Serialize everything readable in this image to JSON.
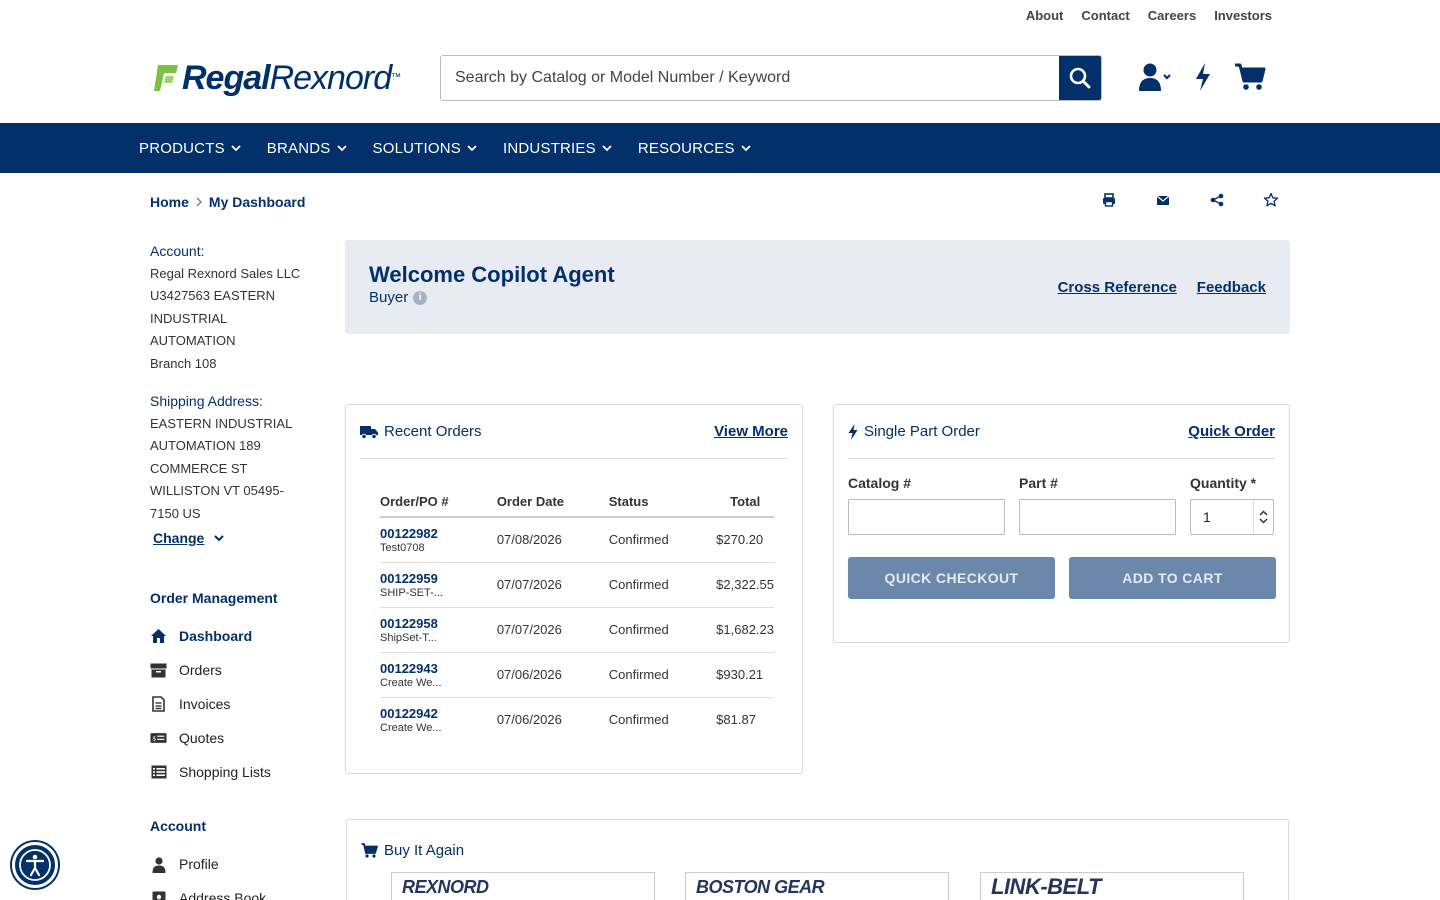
{
  "utility_links": [
    "About",
    "Contact",
    "Careers",
    "Investors"
  ],
  "logo": {
    "bold": "Regal",
    "light": "Rexnord",
    "tm": "™"
  },
  "search": {
    "placeholder": "Search by Catalog or Model Number / Keyword",
    "value": ""
  },
  "header_icons": [
    "user-menu-icon",
    "bolt-icon",
    "cart-icon"
  ],
  "nav": [
    "PRODUCTS",
    "BRANDS",
    "SOLUTIONS",
    "INDUSTRIES",
    "RESOURCES"
  ],
  "breadcrumb": [
    "Home",
    "My Dashboard"
  ],
  "page_tools": [
    "print-icon",
    "email-icon",
    "share-icon",
    "star-icon"
  ],
  "sidebar": {
    "account_label": "Account:",
    "account_lines": [
      "Regal Rexnord Sales LLC",
      "U3427563 EASTERN",
      "INDUSTRIAL",
      "AUTOMATION",
      "Branch 108"
    ],
    "shipping_label": "Shipping Address:",
    "shipping_lines": [
      "EASTERN INDUSTRIAL",
      "AUTOMATION 189",
      "COMMERCE ST",
      "WILLISTON VT 05495-",
      "7150 US"
    ],
    "change_label": "Change",
    "order_mgmt_heading": "Order Management",
    "order_mgmt_items": [
      "Dashboard",
      "Orders",
      "Invoices",
      "Quotes",
      "Shopping Lists"
    ],
    "account_heading": "Account",
    "account_items": [
      "Profile",
      "Address Book"
    ]
  },
  "welcome": {
    "title": "Welcome Copilot Agent",
    "role": "Buyer",
    "info_glyph": "i",
    "links": [
      "Cross Reference",
      "Feedback"
    ]
  },
  "recent_orders": {
    "title": "Recent Orders",
    "view_more": "View More",
    "columns": [
      "Order/PO #",
      "Order Date",
      "Status",
      "Total"
    ],
    "rows": [
      {
        "order": "00122982",
        "po": "Test0708",
        "date": "07/08/2026",
        "status": "Confirmed",
        "total": "$270.20"
      },
      {
        "order": "00122959",
        "po": "SHIP-SET-...",
        "date": "07/07/2026",
        "status": "Confirmed",
        "total": "$2,322.55"
      },
      {
        "order": "00122958",
        "po": "ShipSet-T...",
        "date": "07/07/2026",
        "status": "Confirmed",
        "total": "$1,682.23"
      },
      {
        "order": "00122943",
        "po": "Create We...",
        "date": "07/06/2026",
        "status": "Confirmed",
        "total": "$930.21"
      },
      {
        "order": "00122942",
        "po": "Create We...",
        "date": "07/06/2026",
        "status": "Confirmed",
        "total": "$81.87"
      }
    ]
  },
  "single_part_order": {
    "title": "Single Part Order",
    "quick_order": "Quick Order",
    "catalog_label": "Catalog #",
    "part_label": "Part #",
    "quantity_label": "Quantity *",
    "catalog_value": "",
    "part_value": "",
    "quantity_value": "1",
    "quick_checkout": "QUICK CHECKOUT",
    "add_to_cart": "ADD TO CART"
  },
  "buy_it_again": {
    "title": "Buy It Again",
    "brands": [
      "REXNORD",
      "BOSTON GEAR",
      "LINK-BELT"
    ]
  },
  "colors": {
    "brand_navy": "#03306b",
    "logo_green": "#7bc143",
    "button_disabled": "#6b87ab",
    "welcome_bg": "#e8ecf2"
  }
}
